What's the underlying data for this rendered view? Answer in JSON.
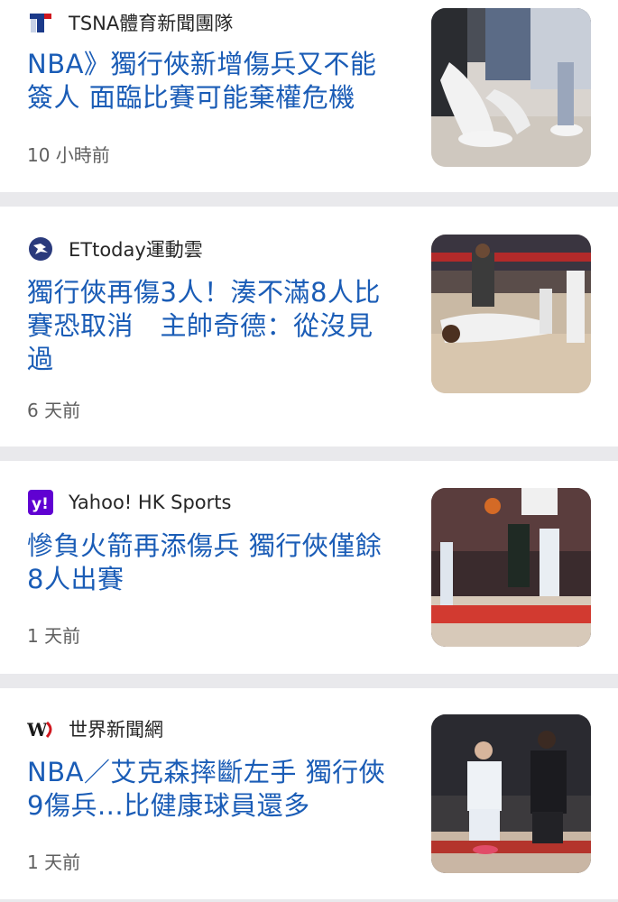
{
  "items": [
    {
      "source": "TSNA體育新聞團隊",
      "logo_icon": "tsna-t-logo-icon",
      "headline": "NBA》獨行俠新增傷兵又不能簽人 面臨比賽可能棄權危機",
      "time": "10 小時前",
      "thumb_icon": "basketball-players-feet-photo"
    },
    {
      "source": "ETtoday運動雲",
      "logo_icon": "ettoday-sports-logo-icon",
      "headline": "獨行俠再傷3人！湊不滿8人比賽恐取消　主帥奇德：從沒見過",
      "time": "6 天前",
      "thumb_icon": "injured-player-on-court-photo"
    },
    {
      "source": "Yahoo! HK Sports",
      "logo_icon": "yahoo-logo-icon",
      "headline": "慘負火箭再添傷兵 獨行俠僅餘8人出賽",
      "time": "1 天前",
      "thumb_icon": "players-layup-photo"
    },
    {
      "source": "世界新聞網",
      "logo_icon": "world-journal-logo-icon",
      "headline": "NBA／艾克森摔斷左手 獨行俠9傷兵...比健康球員還多",
      "time": "1 天前",
      "thumb_icon": "player-dribbling-photo"
    }
  ],
  "colors": {
    "headline": "#1a5cb6",
    "separator": "#e9e9ec",
    "yahoo": "#6001d2",
    "tsna_red": "#d0161e",
    "tsna_blue": "#1b3a8a"
  }
}
